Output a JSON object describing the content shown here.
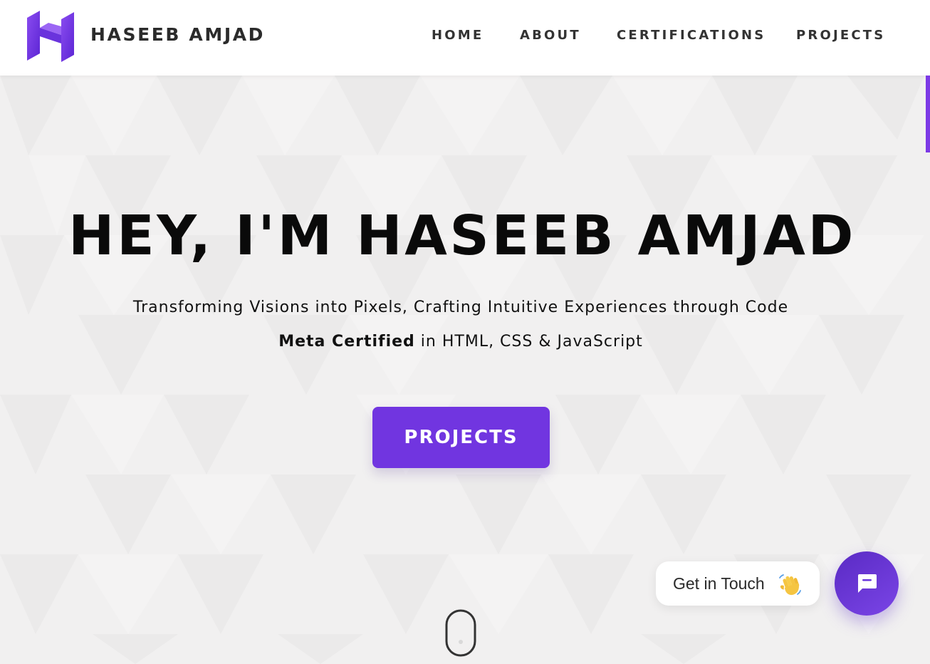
{
  "header": {
    "brand": "HASEEB AMJAD",
    "logo": "logo-h-icon",
    "nav": {
      "home": "HOME",
      "about": "ABOUT",
      "certifications": "CERTIFICATIONS",
      "projects": "PROJECTS"
    }
  },
  "hero": {
    "title": "HEY, I'M HASEEB AMJAD",
    "subtitle": "Transforming Visions into Pixels, Crafting Intuitive Experiences through Code",
    "cert_bold": "Meta Certified",
    "cert_rest": " in HTML, CSS & JavaScript",
    "cta_label": "PROJECTS",
    "scroll_icon": "mouse-scroll-icon"
  },
  "chat": {
    "bubble_text": "Get in Touch",
    "bubble_icon": "waving-hand-icon",
    "button_icon": "chat-icon"
  },
  "colors": {
    "accent": "#7135e0",
    "background": "#f1f0f0",
    "text": "#0a0a0a"
  }
}
